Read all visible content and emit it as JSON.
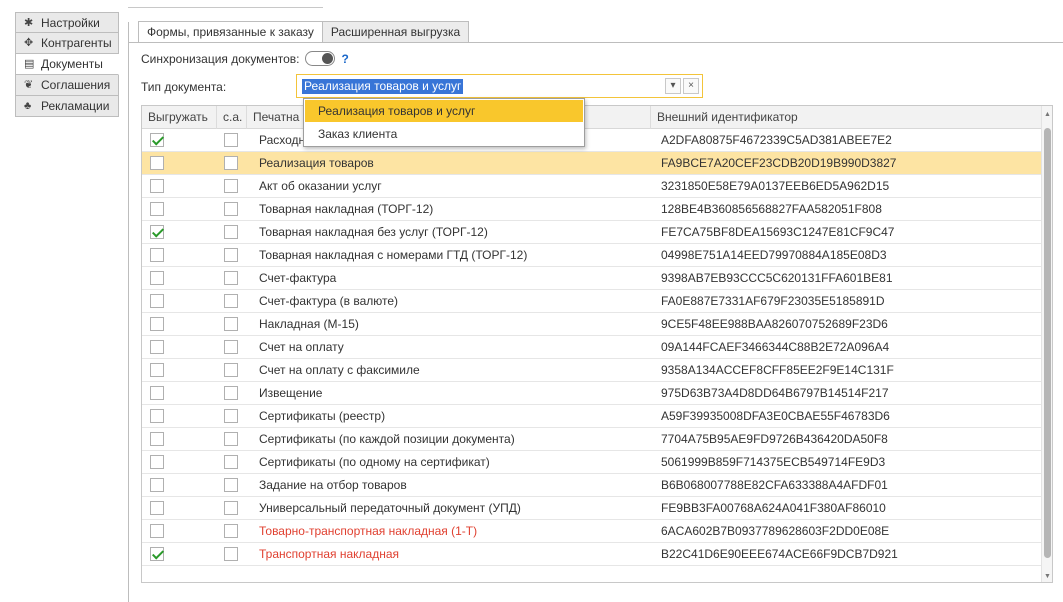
{
  "sidebar": {
    "items": [
      {
        "label": "Настройки",
        "icon": "gear-icon"
      },
      {
        "label": "Контрагенты",
        "icon": "users-icon"
      },
      {
        "label": "Документы",
        "icon": "document-icon"
      },
      {
        "label": "Соглашения",
        "icon": "handshake-icon"
      },
      {
        "label": "Рекламации",
        "icon": "complaint-icon"
      }
    ],
    "active_index": 2
  },
  "tabs": [
    {
      "label": "Формы, привязанные к заказу"
    },
    {
      "label": "Расширенная выгрузка"
    }
  ],
  "sync": {
    "label": "Синхронизация документов:",
    "help": "?"
  },
  "doctype": {
    "label": "Тип документа:",
    "value": "Реализация товаров и услуг",
    "dropdown_glyph": "▾",
    "clear_glyph": "×"
  },
  "popup": {
    "options": [
      "Реализация товаров и услуг",
      "Заказ клиента"
    ],
    "highlighted_index": 0
  },
  "table": {
    "headers": [
      "Выгружать",
      "с.а.",
      "Печатна",
      "Внешний идентификатор"
    ],
    "rows": [
      {
        "export": true,
        "sa": false,
        "name": "Расходн",
        "id": "A2DFA80875F4672339C5AD381ABEE7E2",
        "red": false
      },
      {
        "export": false,
        "sa": false,
        "name": "Реализация товаров",
        "id": "FA9BCE7A20CEF23CDB20D19B990D3827",
        "red": false
      },
      {
        "export": false,
        "sa": false,
        "name": "Акт об оказании услуг",
        "id": "3231850E58E79A0137EEB6ED5A962D15",
        "red": false
      },
      {
        "export": false,
        "sa": false,
        "name": "Товарная накладная (ТОРГ-12)",
        "id": "128BE4B360856568827FAA582051F808",
        "red": false
      },
      {
        "export": true,
        "sa": false,
        "name": "Товарная накладная без услуг (ТОРГ-12)",
        "id": "FE7CA75BF8DEA15693C1247E81CF9C47",
        "red": false
      },
      {
        "export": false,
        "sa": false,
        "name": "Товарная накладная с номерами ГТД (ТОРГ-12)",
        "id": "04998E751A14EED79970884A185E08D3",
        "red": false
      },
      {
        "export": false,
        "sa": false,
        "name": "Счет-фактура",
        "id": "9398AB7EB93CCC5C620131FFA601BE81",
        "red": false
      },
      {
        "export": false,
        "sa": false,
        "name": "Счет-фактура (в валюте)",
        "id": "FA0E887E7331AF679F23035E5185891D",
        "red": false
      },
      {
        "export": false,
        "sa": false,
        "name": "Накладная (М-15)",
        "id": "9CE5F48EE988BAA826070752689F23D6",
        "red": false
      },
      {
        "export": false,
        "sa": false,
        "name": "Счет на оплату",
        "id": "09A144FCAEF3466344C88B2E72A096A4",
        "red": false
      },
      {
        "export": false,
        "sa": false,
        "name": "Счет на оплату с факсимиле",
        "id": "9358A134ACCEF8CFF85EE2F9E14C131F",
        "red": false
      },
      {
        "export": false,
        "sa": false,
        "name": "Извещение",
        "id": "975D63B73A4D8DD64B6797B14514F217",
        "red": false
      },
      {
        "export": false,
        "sa": false,
        "name": "Сертификаты (реестр)",
        "id": "A59F39935008DFA3E0CBAE55F46783D6",
        "red": false
      },
      {
        "export": false,
        "sa": false,
        "name": "Сертификаты (по каждой позиции документа)",
        "id": "7704A75B95AE9FD9726B436420DA50F8",
        "red": false
      },
      {
        "export": false,
        "sa": false,
        "name": "Сертификаты (по одному на сертификат)",
        "id": "5061999B859F714375ECB549714FE9D3",
        "red": false
      },
      {
        "export": false,
        "sa": false,
        "name": "Задание на отбор товаров",
        "id": "B6B068007788E82CFA633388A4AFDF01",
        "red": false
      },
      {
        "export": false,
        "sa": false,
        "name": "Универсальный передаточный документ (УПД)",
        "id": "FE9BB3FA00768A624A041F380AF86010",
        "red": false
      },
      {
        "export": false,
        "sa": false,
        "name": "Товарно-транспортная накладная (1-Т)",
        "id": "6ACA602B7B0937789628603F2DD0E08E",
        "red": true
      },
      {
        "export": true,
        "sa": false,
        "name": "Транспортная накладная",
        "id": "B22C41D6E90EEE674ACE66F9DCB7D921",
        "red": true
      }
    ],
    "selected_index": 1
  },
  "colors": {
    "accent": "#f9c72c",
    "selected_row": "#fde4a3",
    "check": "#2a9a2a",
    "warning_text": "#e04030",
    "help": "#1a67c9"
  }
}
